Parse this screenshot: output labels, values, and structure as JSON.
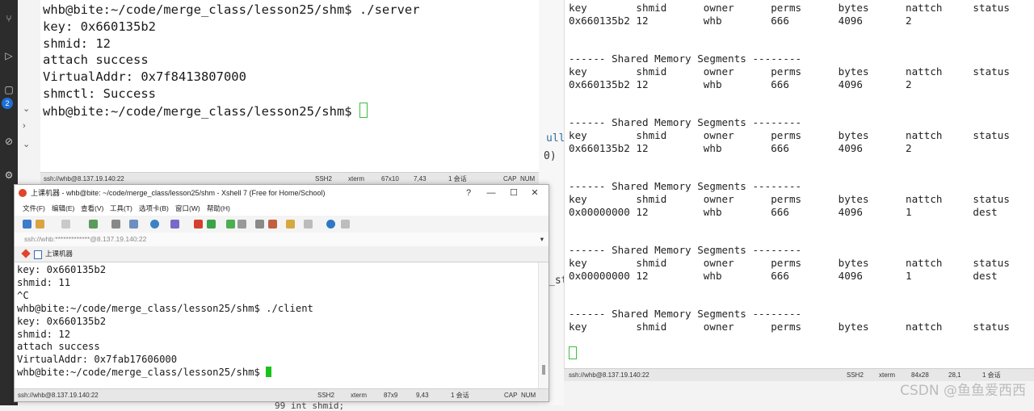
{
  "server_terminal": {
    "lines": [
      "whb@bite:~/code/merge_class/lesson25/shm$ ./server",
      "key: 0x660135b2",
      "shmid: 12",
      "attach success",
      "VirtualAddr: 0x7f8413807000",
      "shmctl: Success",
      "whb@bite:~/code/merge_class/lesson25/shm$ "
    ],
    "status": {
      "conn": "ssh://whb@8.137.19.140:22",
      "proto": "SSH2",
      "term": "xterm",
      "size": "67x10",
      "pos": "7,43",
      "sessions": "1 会话",
      "caps": "CAP",
      "num": "NUM"
    }
  },
  "right_terminal": {
    "lines": [
      "key        shmid      owner      perms      bytes      nattch     status",
      "0x660135b2 12         whb        666        4096       2",
      "",
      "",
      "------ Shared Memory Segments --------",
      "key        shmid      owner      perms      bytes      nattch     status",
      "0x660135b2 12         whb        666        4096       2",
      "",
      "",
      "------ Shared Memory Segments --------",
      "key        shmid      owner      perms      bytes      nattch     status",
      "0x660135b2 12         whb        666        4096       2",
      "",
      "",
      "------ Shared Memory Segments --------",
      "key        shmid      owner      perms      bytes      nattch     status",
      "0x00000000 12         whb        666        4096       1          dest",
      "",
      "",
      "------ Shared Memory Segments --------",
      "key        shmid      owner      perms      bytes      nattch     status",
      "0x00000000 12         whb        666        4096       1          dest",
      "",
      "",
      "------ Shared Memory Segments --------",
      "key        shmid      owner      perms      bytes      nattch     status",
      "",
      ""
    ],
    "status": {
      "conn": "ssh://whb@8.137.19.140:22",
      "proto": "SSH2",
      "term": "xterm",
      "size": "84x28",
      "pos": "28,1",
      "sessions": "1 会话"
    }
  },
  "xshell": {
    "title": "上课机器 - whb@bite: ~/code/merge_class/lesson25/shm - Xshell 7 (Free for Home/School)",
    "window_buttons": [
      "?",
      "—",
      "☐",
      "✕"
    ],
    "menu": [
      "文件(F)",
      "编辑(E)",
      "查看(V)",
      "工具(T)",
      "选项卡(B)",
      "窗口(W)",
      "帮助(H)"
    ],
    "address": "ssh://whb:*************@8.137.19.140:22",
    "tab_label": "上课机器",
    "terminal_lines": [
      "key: 0x660135b2",
      "shmid: 11",
      "^C",
      "whb@bite:~/code/merge_class/lesson25/shm$ ./client",
      "key: 0x660135b2",
      "shmid: 12",
      "attach success",
      "VirtualAddr: 0x7fab17606000",
      "whb@bite:~/code/merge_class/lesson25/shm$ "
    ],
    "status": {
      "conn": "ssh://whb@8.137.19.140:22",
      "proto": "SSH2",
      "term": "xterm",
      "size": "87x9",
      "pos": "9,43",
      "sessions": "1 会话",
      "caps": "CAP",
      "num": "NUM"
    }
  },
  "editor_fragments": {
    "a": "ull",
    "b": "0)",
    "c": "_st",
    "badge": "2",
    "code_below": "99     int  shmid;"
  },
  "watermark": "CSDN @鱼鱼爱西西",
  "colors": {
    "cursor_green": "#19c319",
    "activity_bar": "#2c2c2c",
    "badge_blue": "#1e6fd6"
  }
}
